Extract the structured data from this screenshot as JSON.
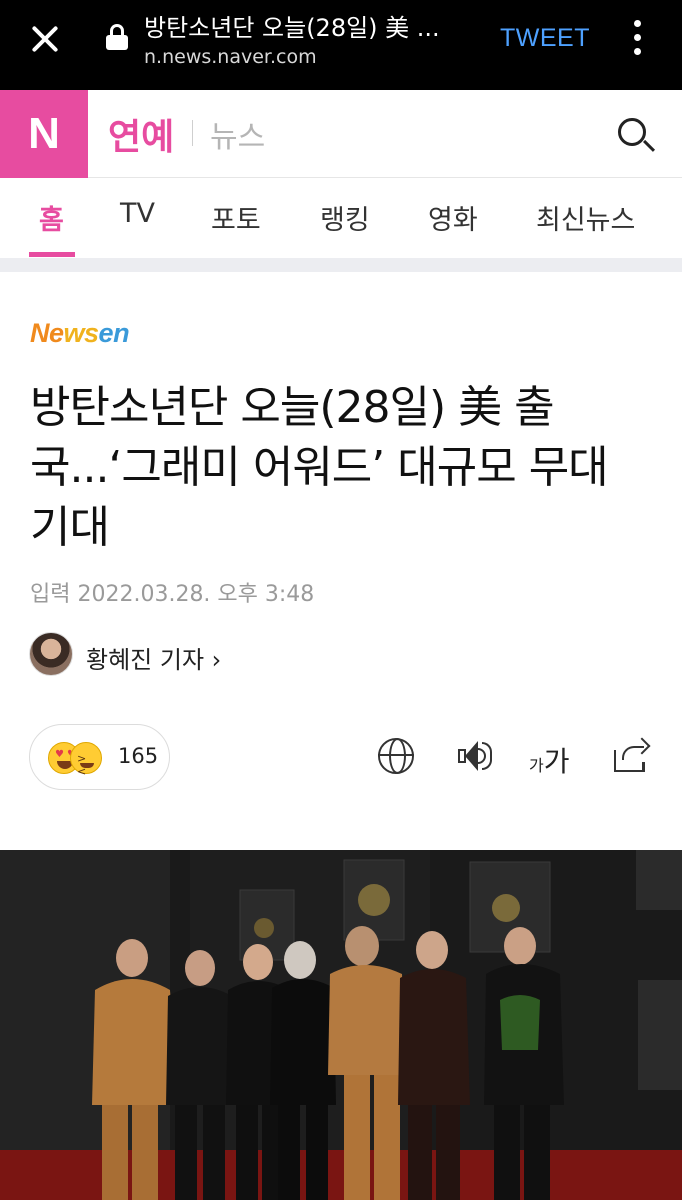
{
  "browser": {
    "tab_title": "방탄소년단 오늘(28일) 美 ...",
    "url": "n.news.naver.com",
    "tweet_label": "TWEET"
  },
  "header": {
    "logo": "N",
    "section": "연예",
    "subsection": "뉴스"
  },
  "tabs": [
    {
      "label": "홈",
      "active": true
    },
    {
      "label": "TV"
    },
    {
      "label": "포토"
    },
    {
      "label": "랭킹"
    },
    {
      "label": "영화"
    },
    {
      "label": "최신뉴스"
    }
  ],
  "article": {
    "press": {
      "part1": "Ne",
      "part2": "ws",
      "part3": "en"
    },
    "headline": "방탄소년단 오늘(28일) 美 출국...‘그래미 어워드’ 대규모 무대 기대",
    "date": "입력 2022.03.28. 오후 3:48",
    "reporter": "황혜진 기자 ›",
    "reaction_count": "165",
    "font_small": "가",
    "font_big": "가"
  },
  "colors": {
    "brand": "#e74ca0",
    "link": "#4ea1ff"
  }
}
